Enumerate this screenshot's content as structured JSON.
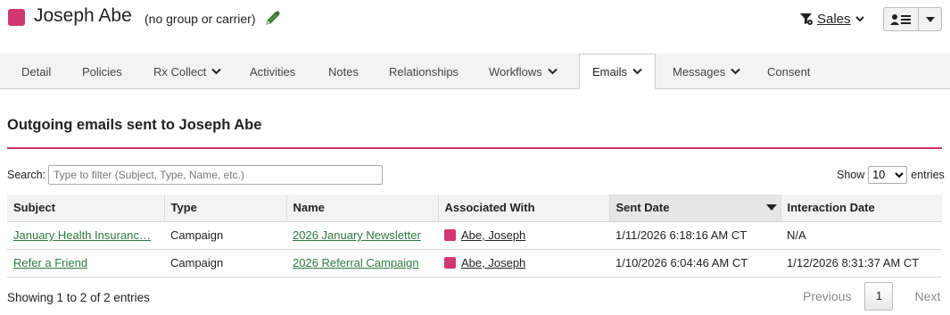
{
  "header": {
    "swatch_color": "#d0376f",
    "name": "Joseph Abe",
    "group": "(no group or carrier)",
    "edit_icon": "pencil-icon",
    "filter_label": "Sales",
    "filter_icon": "filter-icon",
    "user_icon": "user-list-icon"
  },
  "tabs": [
    {
      "label": "Detail",
      "dropdown": false
    },
    {
      "label": "Policies",
      "dropdown": false
    },
    {
      "label": "Rx Collect",
      "dropdown": true
    },
    {
      "label": "Activities",
      "dropdown": false
    },
    {
      "label": "Notes",
      "dropdown": false
    },
    {
      "label": "Relationships",
      "dropdown": false
    },
    {
      "label": "Workflows",
      "dropdown": true
    },
    {
      "label": "Emails",
      "dropdown": true,
      "active": true
    },
    {
      "label": "Messages",
      "dropdown": true
    },
    {
      "label": "Consent",
      "dropdown": false
    }
  ],
  "section": {
    "title": "Outgoing emails sent to Joseph Abe",
    "accent_color": "#c9356c"
  },
  "search": {
    "label": "Search:",
    "placeholder": "Type to filter (Subject, Type, Name, etc.)"
  },
  "show": {
    "prefix": "Show",
    "value": "10",
    "suffix": "entries"
  },
  "table": {
    "headers": [
      "Subject",
      "Type",
      "Name",
      "Associated With",
      "Sent Date",
      "Interaction Date"
    ],
    "sorted_column": "Sent Date",
    "rows": [
      {
        "subject": "January Health Insuranc…",
        "type": "Campaign",
        "name": "2026 January Newsletter",
        "associated": "Abe, Joseph",
        "sent": "1/11/2026 6:18:16 AM CT",
        "interaction": "N/A"
      },
      {
        "subject": "Refer a Friend",
        "type": "Campaign",
        "name": "2026 Referral Campaign",
        "associated": "Abe, Joseph",
        "sent": "1/10/2026 6:04:46 AM CT",
        "interaction": "1/12/2026 8:31:37 AM CT"
      }
    ]
  },
  "footer": {
    "info": "Showing 1 to 2 of 2 entries",
    "previous": "Previous",
    "page": "1",
    "next": "Next"
  }
}
